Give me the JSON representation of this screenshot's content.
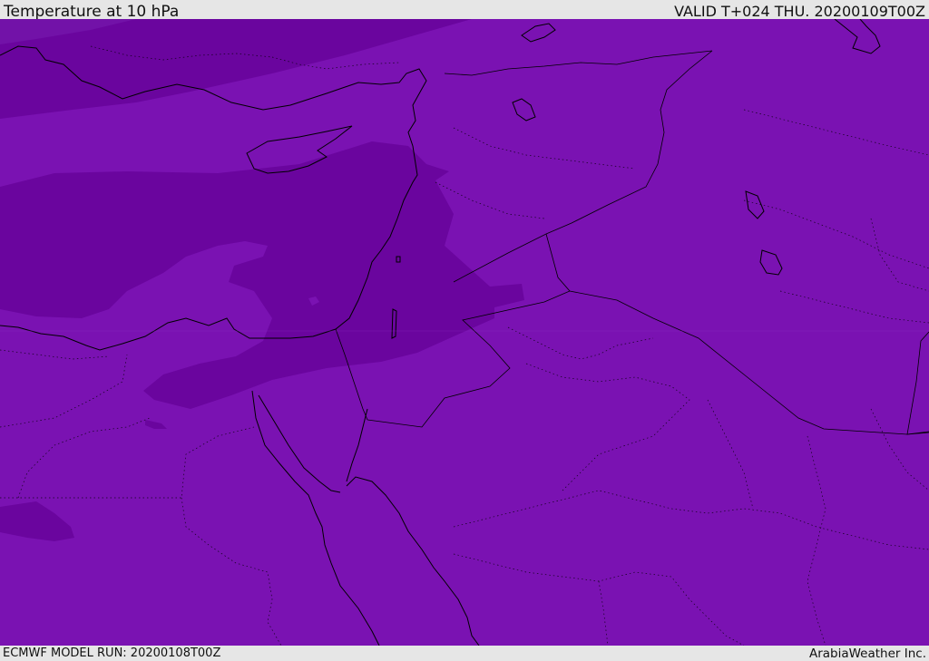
{
  "header": {
    "title": "Temperature at 10 hPa",
    "valid": "VALID T+024 THU. 20200109T00Z"
  },
  "footer": {
    "model_run": "ECMWF MODEL RUN: 20200108T00Z",
    "credit": "ArabiaWeather Inc."
  },
  "map": {
    "colors": {
      "base_field": "#7a12b2",
      "colder_band": "#6a059e",
      "coastline": "#000000",
      "borders": "#000000"
    }
  }
}
